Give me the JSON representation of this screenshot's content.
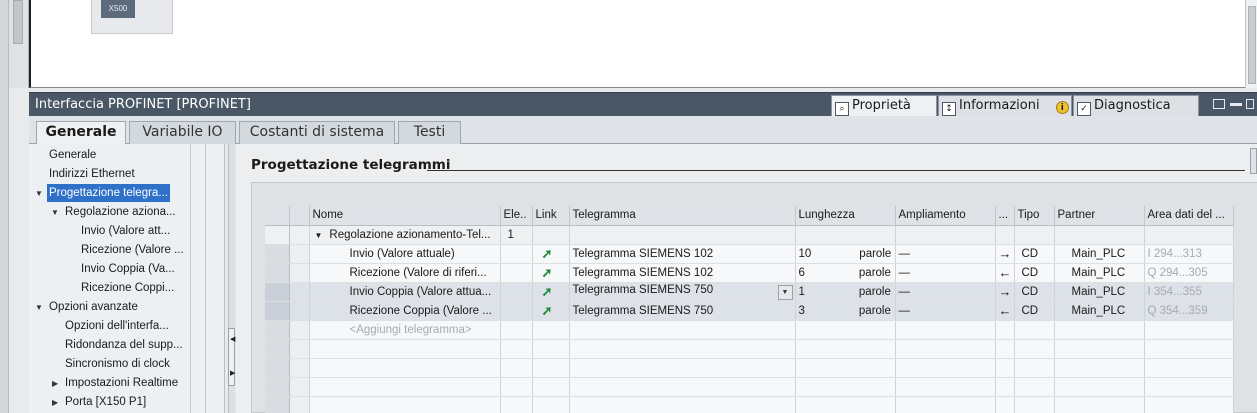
{
  "device_view": {
    "device_chip_label": "X500"
  },
  "inspector": {
    "title": "Interfaccia PROFINET [PROFINET]",
    "tabs": [
      {
        "label": "Proprietà",
        "icon": "properties-icon",
        "active": true
      },
      {
        "label": "Informazioni",
        "icon": "info-icon",
        "badge": "i"
      },
      {
        "label": "Diagnostica",
        "icon": "diagnostics-icon"
      }
    ]
  },
  "main_tabs": [
    "Generale",
    "Variabile IO",
    "Costanti di sistema",
    "Testi"
  ],
  "nav": {
    "items": [
      {
        "label": "Generale",
        "level": 0
      },
      {
        "label": "Indirizzi Ethernet",
        "level": 0
      },
      {
        "label": "Progettazione telegra...",
        "level": 0,
        "expanded": true,
        "selected": true
      },
      {
        "label": "Regolazione aziona...",
        "level": 1,
        "expanded": true
      },
      {
        "label": "Invio (Valore att...",
        "level": 2
      },
      {
        "label": "Ricezione (Valore ...",
        "level": 2
      },
      {
        "label": "Invio Coppia (Va...",
        "level": 2
      },
      {
        "label": "Ricezione Coppi...",
        "level": 2
      },
      {
        "label": "Opzioni avanzate",
        "level": 0,
        "expanded": true
      },
      {
        "label": "Opzioni dell'interfa...",
        "level": 1
      },
      {
        "label": "Ridondanza del supp...",
        "level": 1
      },
      {
        "label": "Sincronismo di clock",
        "level": 1
      },
      {
        "label": "Impostazioni Realtime",
        "level": 1,
        "collapsed": true
      },
      {
        "label": "Porta [X150 P1]",
        "level": 1,
        "collapsed": true
      }
    ]
  },
  "section": {
    "title": "Progettazione telegrammi"
  },
  "table": {
    "headers": [
      "Nome",
      "Ele..",
      "Link",
      "Telegramma",
      "Lunghezza",
      "Ampliamento",
      "...",
      "Tipo",
      "Partner",
      "Area dati del ..."
    ],
    "group_row": {
      "name": "Regolazione azionamento-Tel...",
      "ele": "1"
    },
    "rows": [
      {
        "name": "Invio (Valore attuale)",
        "telegram": "Telegramma SIEMENS 102",
        "length": "10",
        "unit": "parole",
        "extension": "—",
        "direction": "send",
        "type": "CD",
        "partner": "Main_PLC",
        "area": "I 294...313"
      },
      {
        "name": "Ricezione (Valore di riferi...",
        "telegram": "Telegramma SIEMENS 102",
        "length": "6",
        "unit": "parole",
        "extension": "—",
        "direction": "receive",
        "type": "CD",
        "partner": "Main_PLC",
        "area": "Q 294...305"
      },
      {
        "name": "Invio Coppia (Valore attua...",
        "telegram": "Telegramma SIEMENS 750",
        "length": "1",
        "unit": "parole",
        "extension": "—",
        "direction": "send",
        "type": "CD",
        "partner": "Main_PLC",
        "area": "I 354...355",
        "selected": true
      },
      {
        "name": "Ricezione Coppia (Valore ...",
        "telegram": "Telegramma SIEMENS 750",
        "length": "3",
        "unit": "parole",
        "extension": "—",
        "direction": "receive",
        "type": "CD",
        "partner": "Main_PLC",
        "area": "Q 354...359"
      }
    ],
    "add_row_placeholder": "<Aggiungi telegramma>",
    "link_icon": "connected-link-icon"
  },
  "colors": {
    "inspector_bar": "#4a5766",
    "selection": "#2f71c9",
    "link_green": "#1e8a35"
  }
}
